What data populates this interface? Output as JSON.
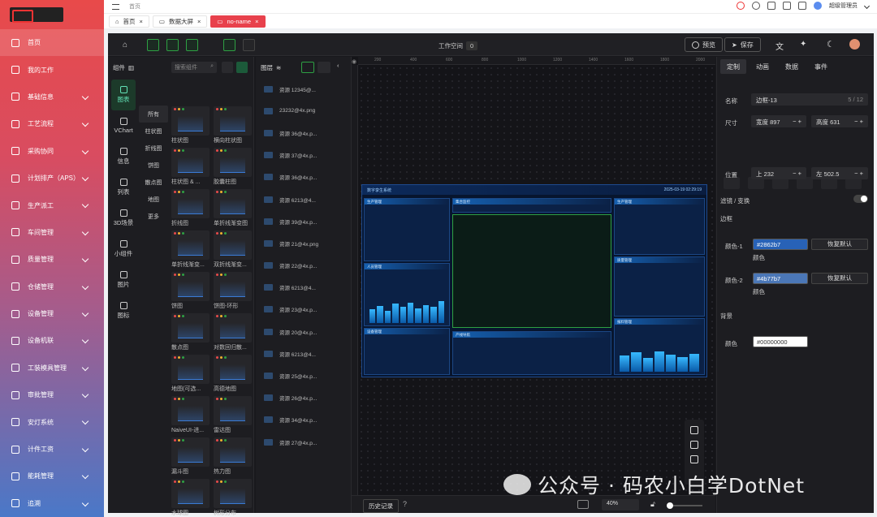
{
  "sidebar": {
    "items": [
      {
        "label": "首页",
        "chev": false
      },
      {
        "label": "我的工作",
        "chev": false
      },
      {
        "label": "基础信息",
        "chev": true
      },
      {
        "label": "工艺流程",
        "chev": true
      },
      {
        "label": "采购协同",
        "chev": true
      },
      {
        "label": "计划排产（APS）",
        "chev": true
      },
      {
        "label": "生产派工",
        "chev": true
      },
      {
        "label": "车间管理",
        "chev": true
      },
      {
        "label": "质量管理",
        "chev": true
      },
      {
        "label": "仓储管理",
        "chev": true
      },
      {
        "label": "设备管理",
        "chev": true
      },
      {
        "label": "设备机联",
        "chev": true
      },
      {
        "label": "工装模具管理",
        "chev": true
      },
      {
        "label": "审批管理",
        "chev": true
      },
      {
        "label": "安灯系统",
        "chev": true
      },
      {
        "label": "计件工资",
        "chev": true
      },
      {
        "label": "能耗管理",
        "chev": true
      },
      {
        "label": "追溯",
        "chev": true
      }
    ]
  },
  "topbar": {
    "breadcrumb": "首页",
    "user": "超级管理员"
  },
  "tabs": [
    {
      "label": "首页",
      "active": false
    },
    {
      "label": "数据大屏",
      "active": false
    },
    {
      "label": "no-name",
      "active": true
    }
  ],
  "editor": {
    "workspace_label": "工作空间",
    "workspace_num": "0",
    "preview": "预览",
    "save": "保存"
  },
  "components": {
    "title": "组件",
    "search_placeholder": "搜索组件",
    "categories": [
      "图表",
      "VChart",
      "信息",
      "列表",
      "3D场景",
      "小组件",
      "图片",
      "图标"
    ],
    "subcats": [
      "所有",
      "柱状图",
      "折线图",
      "饼图",
      "散点图",
      "地图",
      "更多"
    ],
    "cards": [
      "柱状图",
      "横向柱状图",
      "柱状图 & ...",
      "胶囊柱图",
      "折线图",
      "单折线渐变图",
      "单折线渐变...",
      "双折线渐变...",
      "饼图",
      "饼图-环形",
      "散点图",
      "对数回归散...",
      "地图(可选...",
      "高德地图",
      "NaiveUI-进...",
      "雷达图",
      "漏斗图",
      "热力图",
      "水球图",
      "树形分布"
    ]
  },
  "layers": {
    "title": "图层",
    "items": [
      "资源 12345@...",
      "23232@4x.png",
      "资源 36@4x.p...",
      "资源 37@4x.p...",
      "资源 36@4x.p...",
      "资源 6213@4...",
      "资源 39@4x.p...",
      "资源 21@4x.png",
      "资源 22@4x.p...",
      "资源 6213@4...",
      "资源 23@4x.p...",
      "资源 20@4x.p...",
      "资源 6213@4...",
      "资源 25@4x.p...",
      "资源 26@4x.p...",
      "资源 34@4x.p...",
      "资源 27@4x.p..."
    ]
  },
  "canvas": {
    "history": "历史记录",
    "zoom": "40%",
    "ruler": [
      "200",
      "400",
      "600",
      "800",
      "1000",
      "1200",
      "1400",
      "1600",
      "1800",
      "2000"
    ],
    "dashboard_title": "数字孪生系统",
    "dashboard_time": "2025-03-19 02:29:19",
    "panels": [
      "生产管理",
      "人员管理",
      "设备管理",
      "质量管理",
      "报料管理",
      "集合监控",
      "产线导航"
    ]
  },
  "props": {
    "tabs": [
      "定制",
      "动画",
      "数据",
      "事件"
    ],
    "name_label": "名称",
    "name_value": "边框-13",
    "name_count": "5 / 12",
    "size_label": "尺寸",
    "width_label": "宽度",
    "width_value": "897",
    "height_label": "高度",
    "height_value": "631",
    "pos_label": "位置",
    "top_label": "上",
    "top_value": "232",
    "left_label": "左",
    "left_value": "502.5",
    "filter_label": "滤镜 / 变换",
    "border_label": "边框",
    "color1_label": "颜色-1",
    "color1_value": "#2862b7",
    "color2_label": "颜色-2",
    "color2_value": "#4b77b7",
    "color_sub": "颜色",
    "reset": "恢复默认",
    "bg_label": "背景",
    "bg_color_label": "颜色",
    "bg_color_value": "#00000000"
  },
  "watermark": "公众号 · 码农小白学DotNet"
}
